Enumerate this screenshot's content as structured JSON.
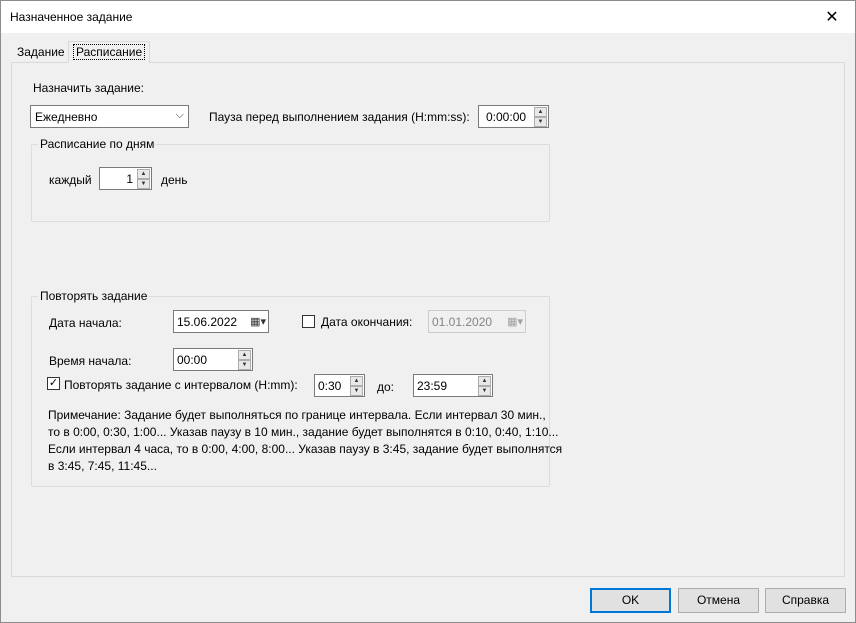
{
  "window": {
    "title": "Назначенное задание"
  },
  "tabs": [
    {
      "label": "Задание"
    },
    {
      "label": "Расписание"
    }
  ],
  "schedule": {
    "assign_label": "Назначить задание:",
    "frequency_value": "Ежедневно",
    "pause_label": "Пауза перед выполнением задания (H:mm:ss):",
    "pause_value": "0:00:00"
  },
  "daily": {
    "group_title": "Расписание по дням",
    "every_label": "каждый",
    "every_value": "1",
    "unit_label": "день"
  },
  "repeat": {
    "group_title": "Повторять задание",
    "start_date_label": "Дата начала:",
    "start_date_value": "15.06.2022",
    "end_date_label": "Дата окончания:",
    "end_date_checked": false,
    "end_date_value": "01.01.2020",
    "start_time_label": "Время начала:",
    "start_time_value": "00:00",
    "interval_label": "Повторять задание с интервалом (H:mm):",
    "interval_checked": true,
    "interval_value": "0:30",
    "until_label": "до:",
    "until_value": "23:59",
    "note_lines": [
      "Примечание: Задание будет выполняться по границе интервала. Если интервал 30 мин.,",
      "то в 0:00, 0:30, 1:00... Указав паузу в 10 мин., задание будет выполнятся в 0:10, 0:40, 1:10...",
      "Если интервал 4 часа, то в 0:00, 4:00, 8:00... Указав паузу в 3:45, задание будет выполнятся",
      "в 3:45, 7:45, 11:45..."
    ]
  },
  "buttons": {
    "ok": "OK",
    "cancel": "Отмена",
    "help": "Справка"
  },
  "icons": {
    "close": "close-icon",
    "dropdown": "chevron-down-icon",
    "calendar": "calendar-icon",
    "spin_up": "arrow-up-icon",
    "spin_down": "arrow-down-icon"
  }
}
